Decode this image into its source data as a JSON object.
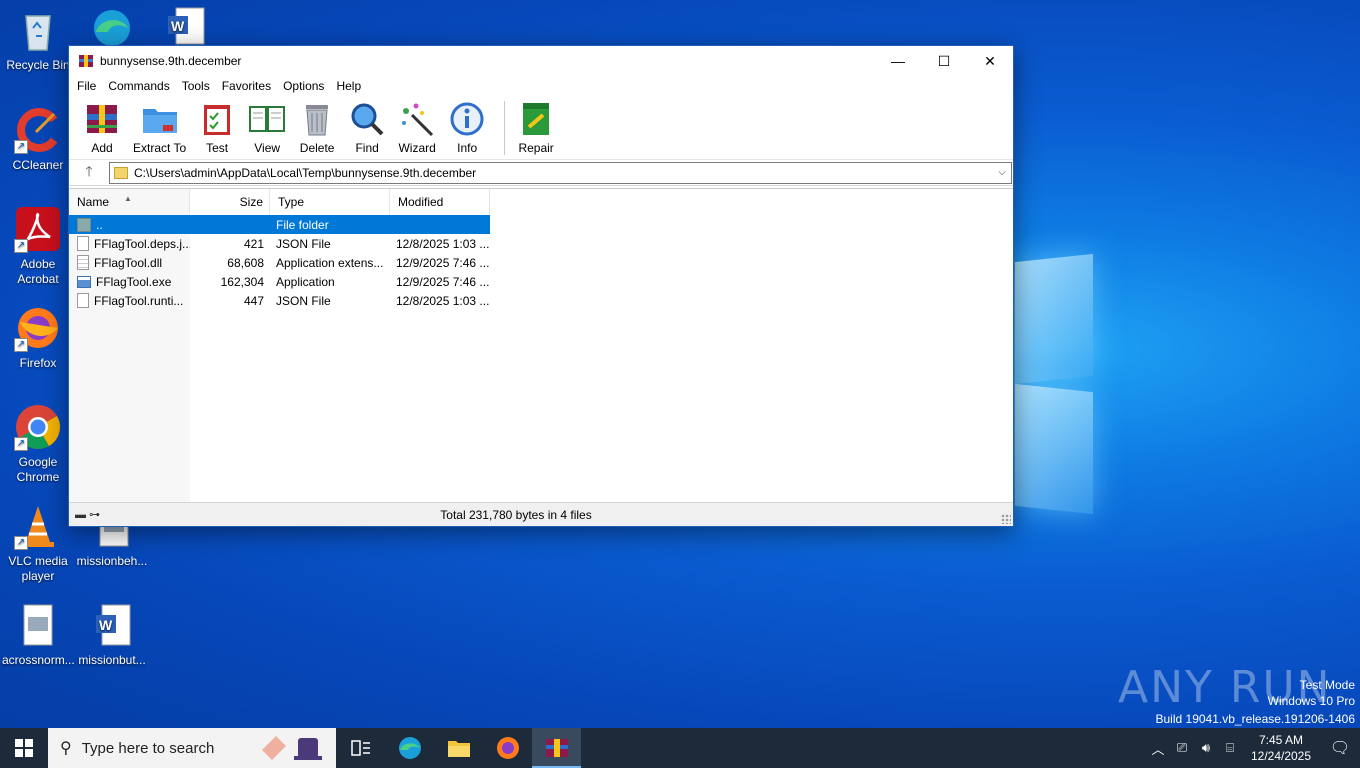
{
  "desktop": {
    "icons": [
      {
        "label": "Recycle Bin"
      },
      {
        "label": "CCleaner"
      },
      {
        "label": "Adobe Acrobat"
      },
      {
        "label": "Firefox"
      },
      {
        "label": "Google Chrome"
      },
      {
        "label": "VLC media player"
      },
      {
        "label": "missionbeh..."
      },
      {
        "label": "acrossnorm..."
      },
      {
        "label": "missionbut..."
      }
    ],
    "watermark": {
      "brand": "ANY RUN",
      "line1": "Test Mode",
      "line2": "Windows 10 Pro",
      "line3": "Build 19041.vb_release.191206-1406"
    }
  },
  "window": {
    "title": "bunnysense.9th.december",
    "menu": [
      "File",
      "Commands",
      "Tools",
      "Favorites",
      "Options",
      "Help"
    ],
    "toolbar": [
      {
        "label": "Add",
        "icon": "add-archive-icon"
      },
      {
        "label": "Extract To",
        "icon": "extract-folder-icon"
      },
      {
        "label": "Test",
        "icon": "test-clipboard-icon"
      },
      {
        "label": "View",
        "icon": "view-book-icon"
      },
      {
        "label": "Delete",
        "icon": "trash-icon"
      },
      {
        "label": "Find",
        "icon": "magnifier-icon"
      },
      {
        "label": "Wizard",
        "icon": "wand-icon"
      },
      {
        "label": "Info",
        "icon": "info-icon"
      },
      {
        "label": "Repair",
        "icon": "repair-icon"
      }
    ],
    "address": "C:\\Users\\admin\\AppData\\Local\\Temp\\bunnysense.9th.december",
    "columns": {
      "name": "Name",
      "size": "Size",
      "type": "Type",
      "modified": "Modified"
    },
    "files": [
      {
        "name": "..",
        "size": "",
        "type": "File folder",
        "modified": "",
        "selected": true
      },
      {
        "name": "FFlagTool.deps.j...",
        "size": "421",
        "type": "JSON File",
        "modified": "12/8/2025 1:03 ..."
      },
      {
        "name": "FFlagTool.dll",
        "size": "68,608",
        "type": "Application extens...",
        "modified": "12/9/2025 7:46 ..."
      },
      {
        "name": "FFlagTool.exe",
        "size": "162,304",
        "type": "Application",
        "modified": "12/9/2025 7:46 ..."
      },
      {
        "name": "FFlagTool.runti...",
        "size": "447",
        "type": "JSON File",
        "modified": "12/8/2025 1:03 ..."
      }
    ],
    "status": "Total 231,780 bytes in 4 files"
  },
  "taskbar": {
    "search_placeholder": "Type here to search",
    "time": "7:45 AM",
    "date": "12/24/2025"
  },
  "colors": {
    "accent": "#0078d7",
    "taskbar": "#1c2a3a"
  }
}
